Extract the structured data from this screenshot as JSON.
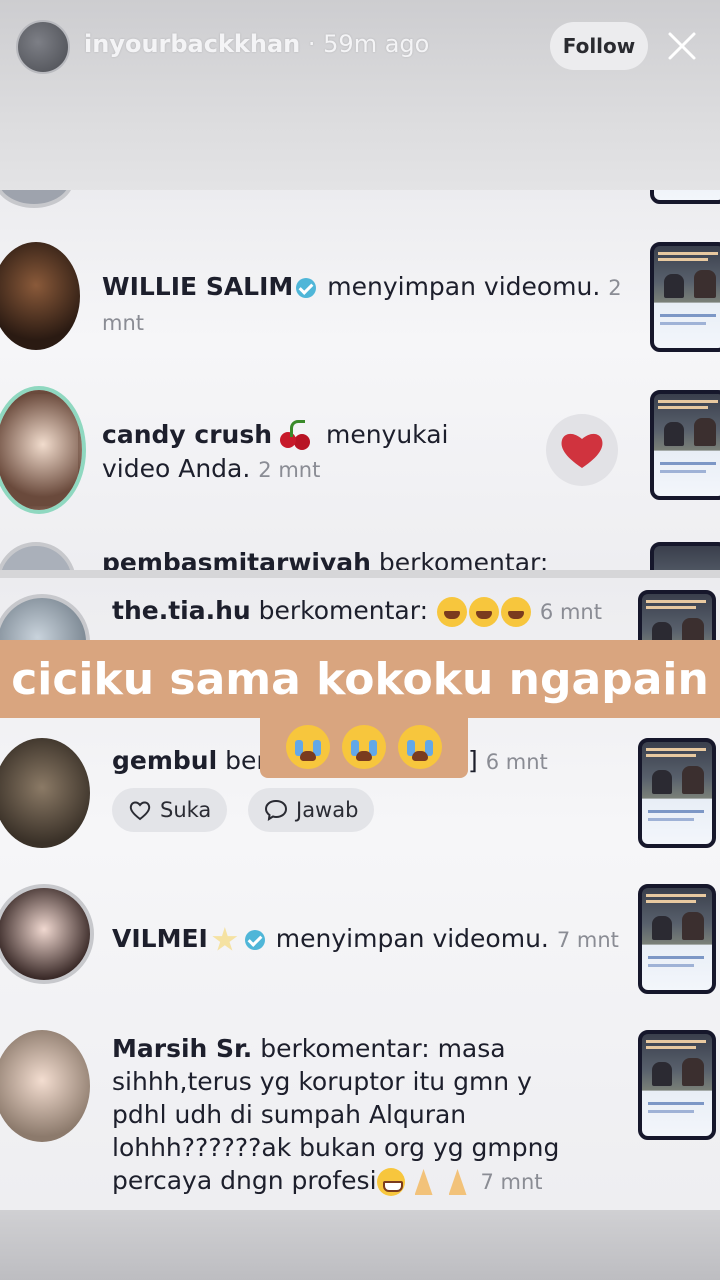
{
  "story": {
    "username": "inyourbackkhan",
    "time": " · 59m ago",
    "follow_label": "Follow"
  },
  "activity_top": [
    {
      "user": "WILLIE SALIM",
      "verified": true,
      "action": " menyimpan videomu.",
      "time": "2 mnt"
    },
    {
      "user": "candy crush",
      "emoji": "cherry",
      "action": " menyukai video Anda.",
      "time": "2 mnt"
    },
    {
      "user": "pembasmitarwiyah",
      "action": " berkomentar:"
    }
  ],
  "activity_bottom": [
    {
      "user": "the.tia.hu",
      "action": " berkomentar:",
      "emoji": "laughing x3",
      "time": "6 mnt"
    },
    {
      "user": "gembul",
      "action": " berl",
      "tail": "]",
      "time": "6 mnt",
      "like_label": "Suka",
      "reply_label": "Jawab"
    },
    {
      "user": "VILMEI",
      "emoji": "star",
      "verified": true,
      "action": " menyimpan videomu.",
      "time": "7 mnt"
    },
    {
      "user": "Marsih Sr.",
      "action": " berkomentar: masa sihhh,terus yg koruptor itu gmn y pdhl udh di sumpah Alquran lohhh??????ak bukan org yg gmpng percaya dngn profesi",
      "emoji": "grin, pray x2",
      "time": "7 mnt"
    }
  ],
  "caption": {
    "line1": "ciciku sama kokoku ngapain",
    "line2_emoji": "loudly-crying x3"
  },
  "colors": {
    "caption_bg": "#d9a57f",
    "verified": "#4fb6d8",
    "heart": "#d0333e"
  }
}
